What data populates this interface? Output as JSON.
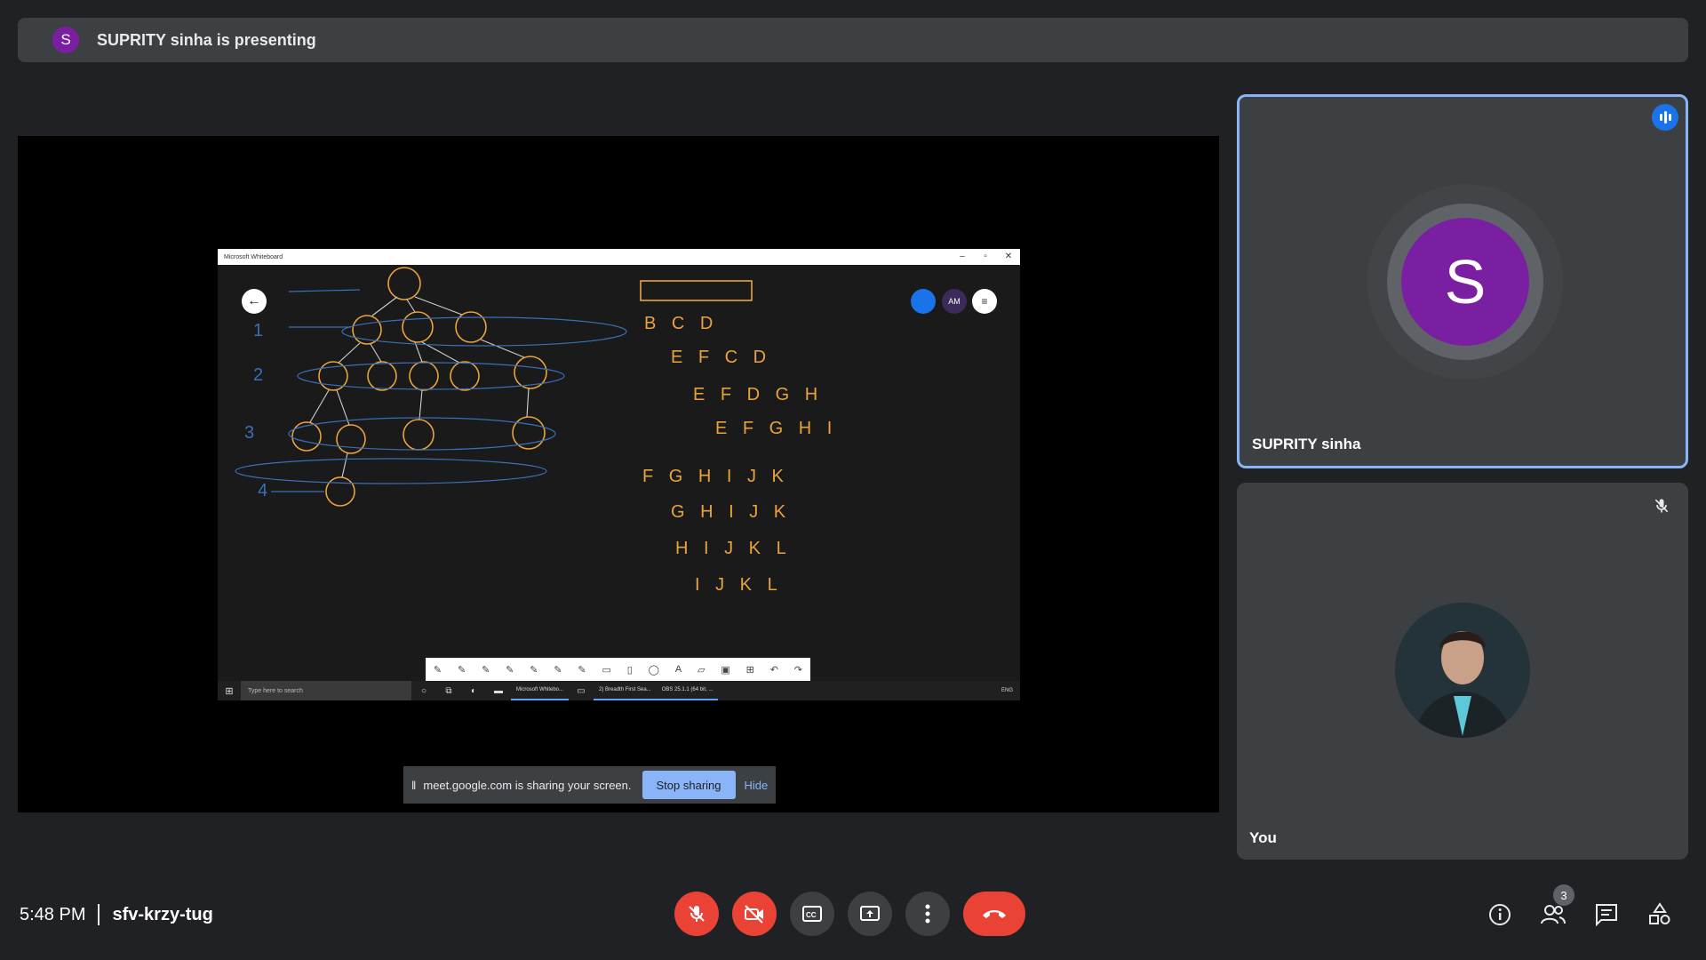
{
  "banner": {
    "avatar_letter": "S",
    "text": "SUPRITY sinha is presenting"
  },
  "shared_window": {
    "title": "Microsoft Whiteboard",
    "controls": [
      "–",
      "▫",
      "✕"
    ],
    "back_glyph": "←",
    "avatars": [
      "",
      "AM",
      "≡"
    ],
    "tools": [
      "✎",
      "✎",
      "✎",
      "✎",
      "✎",
      "✎",
      "✎",
      "▭",
      "▯",
      "◯",
      "A",
      "▱",
      "▣",
      "⊞",
      "↶",
      "↷"
    ],
    "taskbar": {
      "search_placeholder": "Type here to search",
      "apps": [
        "Microsoft Whitebo...",
        "2) Breadth First Sea...",
        "OBS 25.1.1 (64 bit, ..."
      ],
      "tray": "ENG"
    }
  },
  "share_bar": {
    "message": "meet.google.com is sharing your screen.",
    "stop_label": "Stop sharing",
    "hide_label": "Hide"
  },
  "participants": [
    {
      "name": "SUPRITY sinha",
      "avatar_letter": "S",
      "speaking": true
    },
    {
      "name": "You",
      "muted": true
    }
  ],
  "footer": {
    "time": "5:48 PM",
    "meeting_code": "sfv-krzy-tug",
    "participant_count": "3"
  },
  "colors": {
    "accent": "#8ab4f8",
    "danger": "#ea4335",
    "avatar": "#7b1fa2",
    "surface": "#3c4043",
    "bg": "#202124"
  }
}
